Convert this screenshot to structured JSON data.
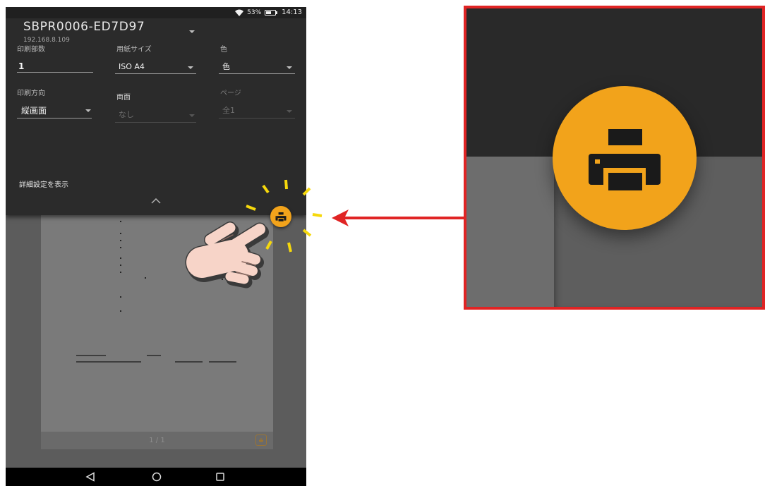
{
  "status_bar": {
    "battery_label": "53%",
    "battery_level": 0.53,
    "time": "14:13"
  },
  "printer": {
    "name": "SBPR0006-ED7D97",
    "address": "192.168.8.109"
  },
  "settings": {
    "copies": {
      "label": "印刷部数",
      "value": "1"
    },
    "paper_size": {
      "label": "用紙サイズ",
      "value": "ISO A4"
    },
    "color_mode": {
      "label": "色",
      "value": "色"
    },
    "orientation": {
      "label": "印刷方向",
      "value": "縦画面"
    },
    "duplex": {
      "label": "両面",
      "value": "なし",
      "enabled": false
    },
    "pages": {
      "label": "ページ",
      "value": "全1",
      "enabled": false
    }
  },
  "more_options_label": "詳細設定を表示",
  "preview": {
    "page_indicator": "1 / 1"
  },
  "icons": {
    "wifi": "wifi-icon",
    "battery": "battery-icon",
    "dropdown": "dropdown-arrow-icon",
    "collapse": "chevron-up-icon",
    "print": "print-icon",
    "back": "back-icon",
    "home": "home-icon",
    "recents": "recents-icon",
    "pointer": "pointing-hand-icon",
    "callout_arrow": "arrow-left-icon"
  },
  "colors": {
    "accent": "#f2a31b",
    "callout": "#e02424",
    "sparkle": "#f6d80c"
  }
}
